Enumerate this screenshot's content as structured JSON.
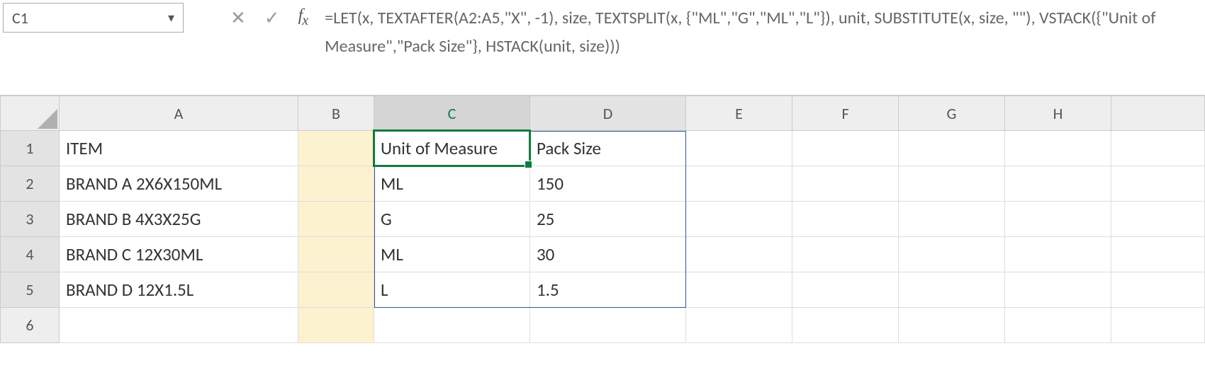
{
  "namebox": {
    "value": "C1"
  },
  "formula": "=LET(x, TEXTAFTER(A2:A5,\"X\", -1), size, TEXTSPLIT(x, {\"ML\",\"G\",\"ML\",\"L\"}), unit, SUBSTITUTE(x, size, \"\"), VSTACK({\"Unit of Measure\",\"Pack Size\"}, HSTACK(unit, size)))",
  "columns": [
    "A",
    "B",
    "C",
    "D",
    "E",
    "F",
    "G",
    "H"
  ],
  "rows": [
    "1",
    "2",
    "3",
    "4",
    "5",
    "6"
  ],
  "cells": {
    "A1": "ITEM",
    "A2": "BRAND A 2X6X150ML",
    "A3": "BRAND B 4X3X25G",
    "A4": "BRAND C 12X30ML",
    "A5": "BRAND D 12X1.5L",
    "C1": "Unit of Measure",
    "D1": "Pack Size",
    "C2": "ML",
    "D2": "150",
    "C3": "G",
    "D3": "25",
    "C4": "ML",
    "D4": "30",
    "C5": "L",
    "D5": "1.5"
  }
}
